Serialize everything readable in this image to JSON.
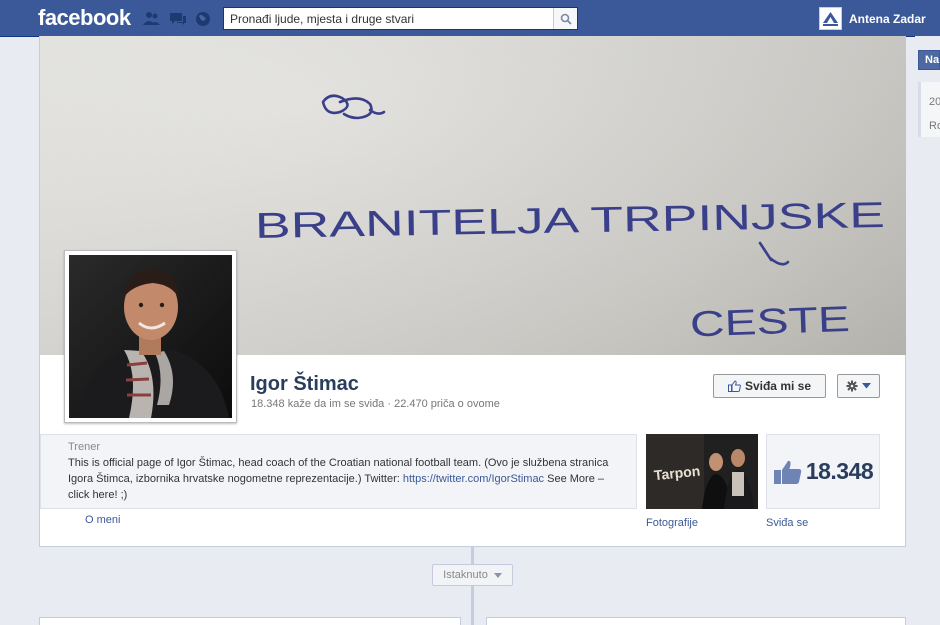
{
  "topbar": {
    "logo": "facebook",
    "search_placeholder": "Pronađi ljude, mjesta i druge stvari",
    "account_name": "Antena Zadar"
  },
  "cover": {
    "handwriting": [
      "BRANITELJA TRPINJSKE",
      "CESTE"
    ]
  },
  "page": {
    "name": "Igor Štimac",
    "stats": "18.348 kaže da im se sviđa · 22.470 priča o ovome",
    "like_button": "Sviđa mi se"
  },
  "about": {
    "label": "Trener",
    "text": "This is official page of Igor Štimac, head coach of the Croatian national football team. (Ovo je službena stranica Igora Štimca, izbornika hrvatske nogometne reprezentacije.) Twitter: ",
    "link": "https://twitter.com/IgorStimac",
    "more": " See More – click here! ;)",
    "tab": "O meni"
  },
  "apps": {
    "photos_label": "Fotografije",
    "likes_count": "18.348",
    "likes_label": "Sviđa se"
  },
  "timeline": {
    "filter": "Istaknuto"
  },
  "sidebar": {
    "button": "Na",
    "line1": "20",
    "line2": "Ro"
  },
  "colors": {
    "fb_blue": "#3b5998",
    "name": "#2b3d5c"
  }
}
